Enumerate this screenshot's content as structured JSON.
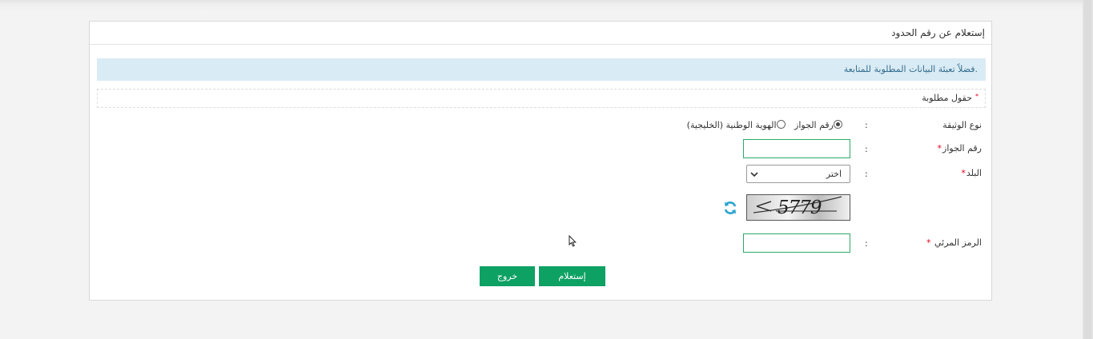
{
  "panel": {
    "title": "إستعلام عن رقم الحدود",
    "alert": "فضلاً تعبئة البيانات المطلوبة للمتابعة.",
    "required_note": "حقول مطلوبة",
    "required_star": "*"
  },
  "form": {
    "colon": ":",
    "doc_type": {
      "label": "نوع الوثيقة",
      "options": [
        {
          "label": "رقم الجواز",
          "selected": true
        },
        {
          "label": "الهوية الوطنية (الخليجية)",
          "selected": false
        }
      ]
    },
    "passport": {
      "label": "رقم الجواز",
      "star": "*",
      "value": ""
    },
    "country": {
      "label": "البلد",
      "star": "*",
      "selected": "اختر"
    },
    "captcha": {
      "image_text": "5779",
      "refresh_icon": "refresh-icon"
    },
    "visual_code": {
      "label": "الرمز المرئي",
      "star": "*",
      "value": ""
    }
  },
  "buttons": {
    "inquiry": "إستعلام",
    "exit": "خروج"
  },
  "colors": {
    "primary_green": "#0ea164",
    "alert_bg": "#d9ebf4",
    "alert_text": "#356d8f",
    "refresh_blue": "#2aa3cf"
  }
}
